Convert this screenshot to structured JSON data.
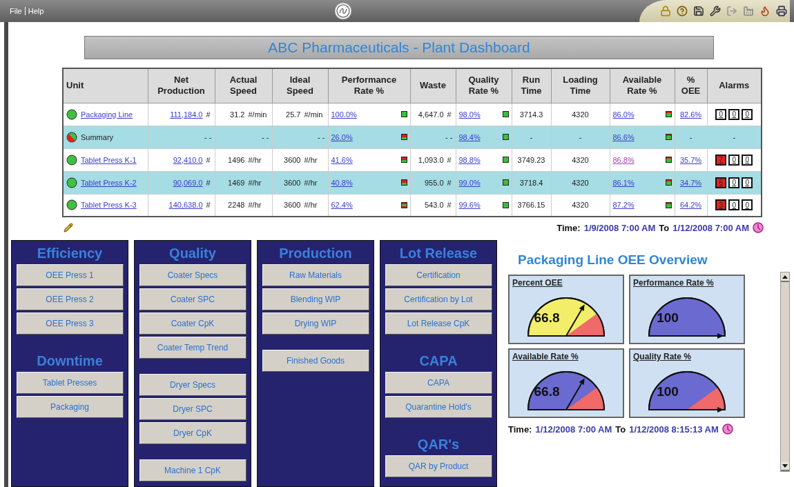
{
  "menu": [
    "File",
    "Help"
  ],
  "title": "ABC Pharmaceuticals - Plant Dashboard",
  "table": {
    "columns": [
      "Unit",
      "Net Production",
      "Actual Speed",
      "Ideal Speed",
      "Performance Rate %",
      "Waste",
      "Quality Rate %",
      "Run Time",
      "Loading Time",
      "Available Rate %",
      "% OEE",
      "Alarms"
    ],
    "rows": [
      {
        "highlight": false,
        "cells": [
          {
            "kind": "unit_link",
            "text": "Packaging Line",
            "status": {
              "kind": "ok"
            }
          },
          {
            "kind": "qty_link",
            "text": "111,184.0",
            "suffix": "#"
          },
          {
            "kind": "qty",
            "text": "31.2",
            "suffix": "#/min"
          },
          {
            "kind": "qty",
            "text": "25.7",
            "suffix": "#/min"
          },
          {
            "kind": "rate",
            "text": "100.0%",
            "indicator": {
              "kind": "good"
            },
            "visited": false
          },
          {
            "kind": "qty",
            "text": "4,647.0",
            "suffix": "#"
          },
          {
            "kind": "rate",
            "text": "98.0%",
            "indicator": {
              "kind": "good"
            },
            "visited": false
          },
          {
            "kind": "plain",
            "text": "3714.3"
          },
          {
            "kind": "plain",
            "text": "4320"
          },
          {
            "kind": "rate",
            "text": "86.0%",
            "indicator": {
              "kind": "fair"
            },
            "visited": false
          },
          {
            "kind": "rate",
            "text": "82.6%",
            "visited": false
          },
          {
            "kind": "alarms",
            "alarms": [
              {
                "count": "0",
                "alert": false
              },
              {
                "count": "0",
                "alert": false
              },
              {
                "count": "0",
                "alert": false
              }
            ]
          }
        ]
      },
      {
        "highlight": true,
        "cells": [
          {
            "kind": "unit",
            "text": "Summary",
            "status": {
              "kind": "mixed"
            }
          },
          {
            "kind": "qty",
            "text": "- -"
          },
          {
            "kind": "qty",
            "text": "- -"
          },
          {
            "kind": "qty",
            "text": "- -"
          },
          {
            "kind": "rate",
            "text": "26.0%",
            "indicator": {
              "kind": "poor"
            },
            "visited": false
          },
          {
            "kind": "qty",
            "text": "- -"
          },
          {
            "kind": "rate",
            "text": "98.4%",
            "indicator": {
              "kind": "good"
            },
            "visited": false
          },
          {
            "kind": "plain",
            "text": "-"
          },
          {
            "kind": "plain",
            "text": "-"
          },
          {
            "kind": "rate",
            "text": "86.6%",
            "indicator": {
              "kind": "fair"
            },
            "visited": false
          },
          {
            "kind": "plain",
            "text": "-"
          },
          {
            "kind": "plain",
            "text": "-"
          }
        ]
      },
      {
        "highlight": false,
        "cells": [
          {
            "kind": "unit_link",
            "text": "Tablet Press K-1",
            "status": {
              "kind": "ok"
            }
          },
          {
            "kind": "qty_link",
            "text": "92,410.0",
            "suffix": "#"
          },
          {
            "kind": "qty",
            "text": "1496",
            "suffix": "#/hr"
          },
          {
            "kind": "qty",
            "text": "3600",
            "suffix": "#/hr"
          },
          {
            "kind": "rate",
            "text": "41.6%",
            "indicator": {
              "kind": "poor"
            },
            "visited": false
          },
          {
            "kind": "qty",
            "text": "1,093.0",
            "suffix": "#"
          },
          {
            "kind": "rate",
            "text": "98.8%",
            "indicator": {
              "kind": "good"
            },
            "visited": false
          },
          {
            "kind": "plain",
            "text": "3749.23"
          },
          {
            "kind": "plain",
            "text": "4320"
          },
          {
            "kind": "rate",
            "text": "86.8%",
            "indicator": {
              "kind": "fair"
            },
            "visited": true
          },
          {
            "kind": "rate",
            "text": "35.7%",
            "visited": false
          },
          {
            "kind": "alarms",
            "alarms": [
              {
                "count": "7",
                "alert": true
              },
              {
                "count": "0",
                "alert": false
              },
              {
                "count": "0",
                "alert": false
              }
            ]
          }
        ]
      },
      {
        "highlight": true,
        "cells": [
          {
            "kind": "unit_link",
            "text": "Tablet Press K-2",
            "status": {
              "kind": "ok"
            }
          },
          {
            "kind": "qty_link",
            "text": "90,069.0",
            "suffix": "#"
          },
          {
            "kind": "qty",
            "text": "1469",
            "suffix": "#/hr"
          },
          {
            "kind": "qty",
            "text": "3600",
            "suffix": "#/hr"
          },
          {
            "kind": "rate",
            "text": "40.8%",
            "indicator": {
              "kind": "poor"
            },
            "visited": false
          },
          {
            "kind": "qty",
            "text": "955.0",
            "suffix": "#"
          },
          {
            "kind": "rate",
            "text": "99.0%",
            "indicator": {
              "kind": "good"
            },
            "visited": false
          },
          {
            "kind": "plain",
            "text": "3718.4"
          },
          {
            "kind": "plain",
            "text": "4320"
          },
          {
            "kind": "rate",
            "text": "86.1%",
            "indicator": {
              "kind": "fair"
            },
            "visited": false
          },
          {
            "kind": "rate",
            "text": "34.7%",
            "visited": false
          },
          {
            "kind": "alarms",
            "alarms": [
              {
                "count": "6",
                "alert": true
              },
              {
                "count": "0",
                "alert": false
              },
              {
                "count": "0",
                "alert": false
              }
            ]
          }
        ]
      },
      {
        "highlight": false,
        "cells": [
          {
            "kind": "unit_link",
            "text": "Tablet Press K-3",
            "status": {
              "kind": "ok"
            }
          },
          {
            "kind": "qty_link",
            "text": "140,638.0",
            "suffix": "#"
          },
          {
            "kind": "qty",
            "text": "2248",
            "suffix": "#/hr"
          },
          {
            "kind": "qty",
            "text": "3600",
            "suffix": "#/hr"
          },
          {
            "kind": "rate",
            "text": "62.4%",
            "indicator": {
              "kind": "mid"
            },
            "visited": false
          },
          {
            "kind": "qty",
            "text": "543.0",
            "suffix": "#"
          },
          {
            "kind": "rate",
            "text": "99.6%",
            "indicator": {
              "kind": "good"
            },
            "visited": false
          },
          {
            "kind": "plain",
            "text": "3766.15"
          },
          {
            "kind": "plain",
            "text": "4320"
          },
          {
            "kind": "rate",
            "text": "87.2%",
            "indicator": {
              "kind": "fair"
            },
            "visited": false
          },
          {
            "kind": "rate",
            "text": "64.2%",
            "visited": false
          },
          {
            "kind": "alarms",
            "alarms": [
              {
                "count": "3",
                "alert": true
              },
              {
                "count": "0",
                "alert": false
              },
              {
                "count": "0",
                "alert": false
              }
            ]
          }
        ]
      }
    ]
  },
  "table_time": {
    "label": "Time:",
    "from": "1/9/2008  7:00 AM",
    "joiner": "To",
    "to": "1/12/2008 7:00 AM"
  },
  "panels": [
    {
      "sections": [
        {
          "heading": "Efficiency",
          "groups": [
            [
              "OEE Press 1",
              "OEE Press 2",
              "OEE Press 3"
            ]
          ]
        },
        {
          "heading": "Downtime",
          "groups": [
            [
              "Tablet Presses",
              "Packaging"
            ]
          ]
        }
      ]
    },
    {
      "sections": [
        {
          "heading": "Quality",
          "groups": [
            [
              "Coater Specs",
              "Coater SPC",
              "Coater CpK",
              "Coater Temp Trend"
            ],
            [
              "Dryer Specs",
              "Dryer SPC",
              "Dryer CpK"
            ],
            [
              "Machine 1 CpK"
            ]
          ]
        }
      ]
    },
    {
      "sections": [
        {
          "heading": "Production",
          "groups": [
            [
              "Raw Materials",
              "Blending WIP",
              "Drying WIP"
            ],
            [
              "Finished Goods"
            ]
          ]
        }
      ]
    },
    {
      "sections": [
        {
          "heading": "Lot Release",
          "groups": [
            [
              "Certification",
              "Certification by Lot",
              "Lot Release CpK"
            ]
          ]
        },
        {
          "heading": "CAPA",
          "groups": [
            [
              "CAPA",
              "Quarantine Hold's"
            ]
          ]
        },
        {
          "heading": "QAR's",
          "groups": [
            [
              "QAR by Product"
            ]
          ]
        }
      ]
    }
  ],
  "overview": {
    "title": "Packaging Line OEE Overview",
    "gauges": [
      {
        "kind": "split",
        "title": "Percent OEE",
        "value": "66.8",
        "color": "#f2ee6a"
      },
      {
        "kind": "solid",
        "title": "Performance Rate %",
        "value": "100",
        "color": "#6a6ad0"
      },
      {
        "kind": "split",
        "title": "Available Rate %",
        "value": "66.8",
        "color": "#6a6ad0"
      },
      {
        "kind": "split",
        "title": "Quality Rate %",
        "value": "100",
        "color": "#6a6ad0"
      }
    ],
    "time": {
      "label": "Time:",
      "from": "1/12/2008  7:00 AM",
      "joiner": "To",
      "to": "1/12/2008 8:15:13 AM"
    }
  }
}
